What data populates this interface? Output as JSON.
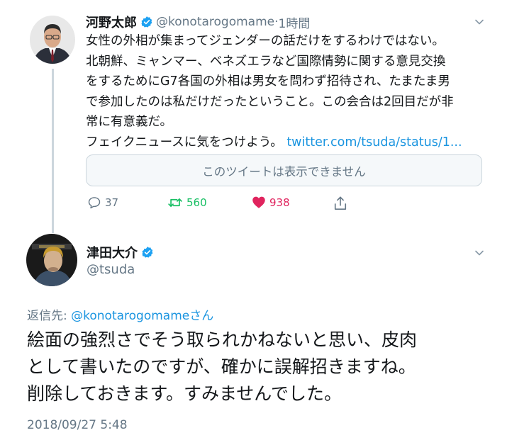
{
  "original_tweet": {
    "author_name": "河野太郎",
    "handle": "@konotarogomame",
    "separator": "·",
    "time_ago": "1時間",
    "text_lines": [
      "女性の外相が集まってジェンダーの話だけをするわけではない。",
      "北朝鮮、ミャンマー、ベネズエラなど国際情勢に関する意見交換",
      "をするためにG7各国の外相は男女を問わず招待され、たまたま男",
      "で参加したのは私だけだったということ。この会合は2回目だが非",
      "常に有意義だ。"
    ],
    "last_line_text": "フェイクニュースに気をつけよう。",
    "link_text": "twitter.com/tsuda/status/1...",
    "unavailable_notice": "このツイートは表示できません",
    "actions": {
      "reply_count": "37",
      "retweet_count": "560",
      "like_count": "938"
    }
  },
  "reply_tweet": {
    "author_name": "津田大介",
    "handle": "@tsuda",
    "replying_to_label": "返信先:",
    "replying_to_handle": "@konotarogomame",
    "replying_to_suffix": "さん",
    "text_lines": [
      "絵面の強烈さでそう取られかねないと思い、皮肉",
      "として書いたのですが、確かに誤解招きますね。",
      "削除しておきます。すみませんでした。"
    ],
    "timestamp": "2018/09/27 5:48"
  },
  "colors": {
    "link": "#1b95e0",
    "retweet": "#17bf63",
    "like": "#e0245e",
    "secondary_text": "#657786"
  }
}
